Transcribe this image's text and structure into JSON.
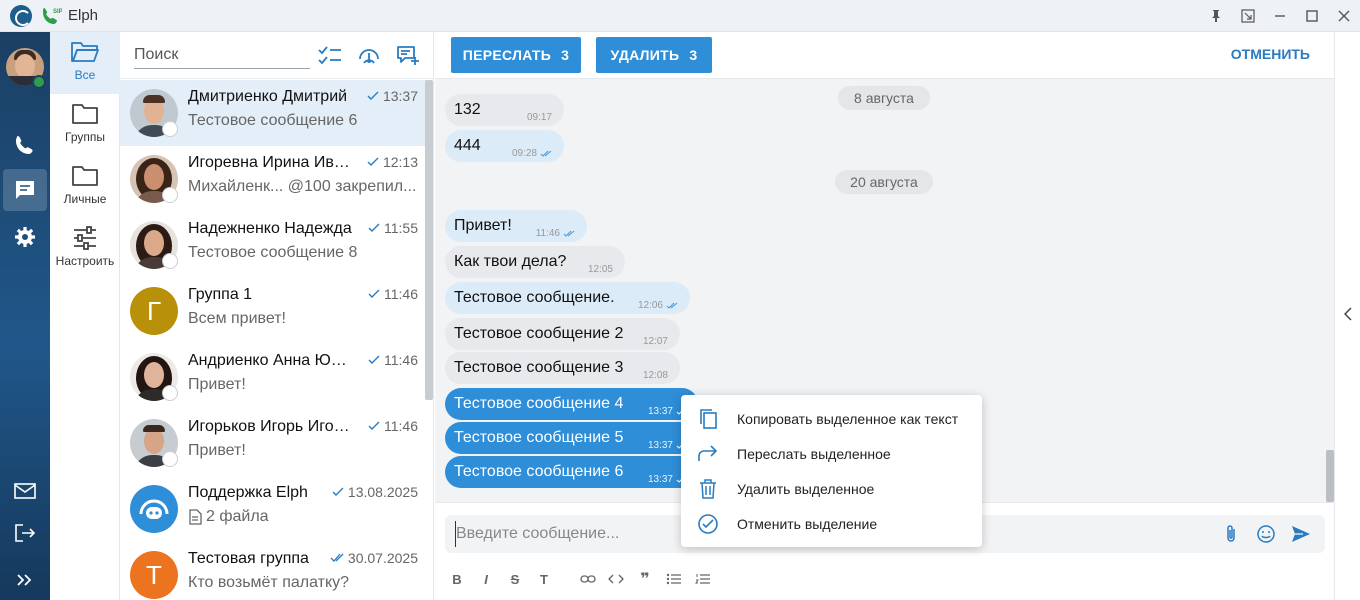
{
  "app": {
    "title": "Elph",
    "sip_badge": "SIP"
  },
  "folders": [
    {
      "label": "Все",
      "icon": "folder-open-icon",
      "active": true
    },
    {
      "label": "Группы",
      "icon": "folder-icon",
      "active": false
    },
    {
      "label": "Личные",
      "icon": "folder-icon",
      "active": false
    },
    {
      "label": "Настроить",
      "icon": "sliders-icon",
      "active": false
    }
  ],
  "search": {
    "placeholder": "Поиск"
  },
  "chats": [
    {
      "name": "Дмитриенко Дмитрий",
      "message": "Тестовое сообщение 6",
      "time": "13:37",
      "read": "sent"
    },
    {
      "name": "Игоревна Ирина Иванова",
      "message": "Михайленк... @100 закрепил...",
      "time": "12:13",
      "read": "sent"
    },
    {
      "name": "Надежненко Надежда",
      "message": "Тестовое сообщение 8",
      "time": "11:55",
      "read": "sent"
    },
    {
      "name": "Группа 1",
      "message": "Всем привет!",
      "time": "11:46",
      "read": "sent",
      "letter": "Г"
    },
    {
      "name": "Андриенко Анна Юрьевна",
      "message": "Привет!",
      "time": "11:46",
      "read": "sent"
    },
    {
      "name": "Игорьков Игорь Игоревич",
      "message": "Привет!",
      "time": "11:46",
      "read": "sent"
    },
    {
      "name": "Поддержка Elph",
      "message": "2 файла",
      "time": "13.08.2025",
      "read": "sent"
    },
    {
      "name": "Тестовая группа",
      "message": "Кто возьмёт палатку?",
      "time": "30.07.2025",
      "read": "read",
      "letter": "Т"
    }
  ],
  "toolbar": {
    "forward_label": "ПЕРЕСЛАТЬ",
    "forward_count": "3",
    "delete_label": "УДАЛИТЬ",
    "delete_count": "3",
    "cancel_label": "ОТМЕНИТЬ"
  },
  "dates": [
    "8 августа",
    "20 августа"
  ],
  "messages": [
    {
      "text": "132",
      "time": "09:17",
      "status": "none",
      "kind": "in"
    },
    {
      "text": "444",
      "time": "09:28",
      "status": "read",
      "kind": "out"
    },
    {
      "text": "Привет!",
      "time": "11:46",
      "status": "read",
      "kind": "out"
    },
    {
      "text": "Как твои дела?",
      "time": "12:05",
      "status": "none",
      "kind": "in"
    },
    {
      "text": "Тестовое сообщение.",
      "time": "12:06",
      "status": "read",
      "kind": "out"
    },
    {
      "text": "Тестовое сообщение 2",
      "time": "12:07",
      "status": "none",
      "kind": "in"
    },
    {
      "text": "Тестовое сообщение 3",
      "time": "12:08",
      "status": "none",
      "kind": "in"
    },
    {
      "text": "Тестовое сообщение 4",
      "time": "13:37",
      "status": "sent",
      "kind": "selected"
    },
    {
      "text": "Тестовое сообщение 5",
      "time": "13:37",
      "status": "sent",
      "kind": "selected"
    },
    {
      "text": "Тестовое сообщение 6",
      "time": "13:37",
      "status": "sent",
      "kind": "selected"
    }
  ],
  "composer": {
    "placeholder": "Введите сообщение..."
  },
  "context_menu": [
    {
      "label": "Копировать выделенное как текст",
      "icon": "copy-icon"
    },
    {
      "label": "Переслать выделенное",
      "icon": "forward-arrow-icon"
    },
    {
      "label": "Удалить выделенное",
      "icon": "trash-icon"
    },
    {
      "label": "Отменить выделение",
      "icon": "check-circle-icon"
    }
  ],
  "colors": {
    "accent": "#2f8ed8",
    "rail": "#1b3f63",
    "selected_bg": "#e3eef8"
  }
}
